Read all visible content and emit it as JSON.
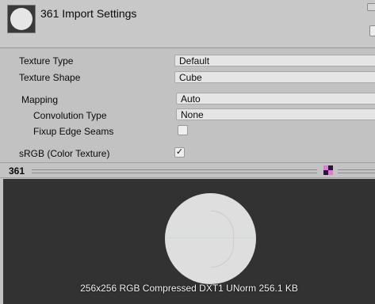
{
  "header": {
    "title": "361 Import Settings"
  },
  "settings": {
    "texture_type": {
      "label": "Texture Type",
      "value": "Default"
    },
    "texture_shape": {
      "label": "Texture Shape",
      "value": "Cube"
    },
    "mapping": {
      "label": "Mapping",
      "value": "Auto"
    },
    "convolution_type": {
      "label": "Convolution Type",
      "value": "None"
    },
    "fixup_edge_seams": {
      "label": "Fixup Edge Seams",
      "checked": false
    },
    "srgb": {
      "label": "sRGB (Color Texture)",
      "checked": true,
      "check_glyph": "✓"
    }
  },
  "preview": {
    "name": "361",
    "info": "256x256  RGB Compressed DXT1 UNorm   256.1 KB"
  }
}
